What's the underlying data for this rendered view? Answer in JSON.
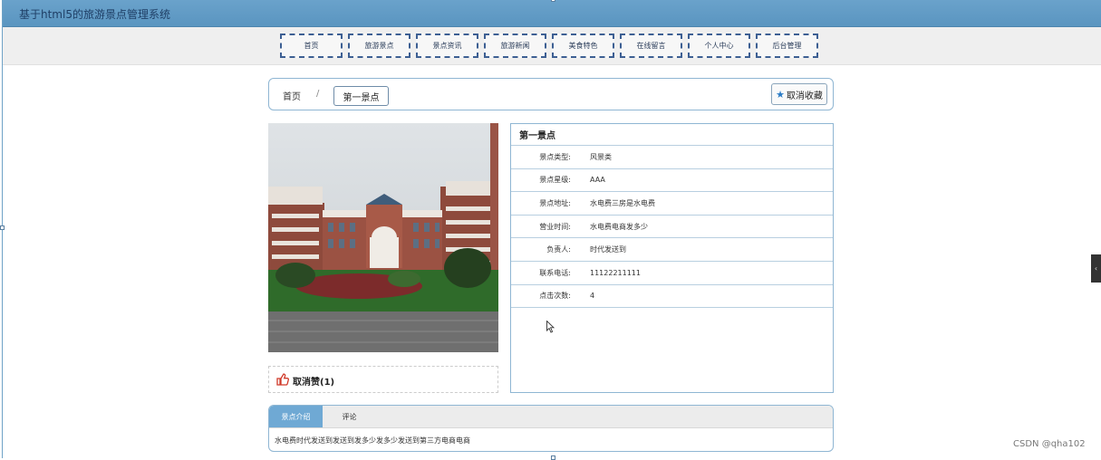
{
  "window": {
    "title": "基于html5的旅游景点管理系统"
  },
  "nav": {
    "items": [
      {
        "label": "首页"
      },
      {
        "label": "旅游景点"
      },
      {
        "label": "景点资讯"
      },
      {
        "label": "旅游新闻"
      },
      {
        "label": "美食特色"
      },
      {
        "label": "在线留言"
      },
      {
        "label": "个人中心"
      },
      {
        "label": "后台管理"
      }
    ]
  },
  "breadcrumb": {
    "home": "首页",
    "separator": "/",
    "current": "第一景点"
  },
  "favorite": {
    "label": "取消收藏",
    "icon": "star-icon"
  },
  "like": {
    "label": "取消赞(1)",
    "icon": "thumbs-up-icon"
  },
  "detail": {
    "name": "第一景点",
    "rows": [
      {
        "key": "景点类型:",
        "value": "风景类"
      },
      {
        "key": "景点星级:",
        "value": "AAA"
      },
      {
        "key": "景点地址:",
        "value": "水电费三房是水电费"
      },
      {
        "key": "营业时间:",
        "value": "水电费电商发多少"
      },
      {
        "key": "负责人:",
        "value": "时代发送到"
      },
      {
        "key": "联系电话:",
        "value": "11122211111"
      },
      {
        "key": "点击次数:",
        "value": "4"
      }
    ]
  },
  "tabs": {
    "items": [
      {
        "label": "景点介绍",
        "active": true
      },
      {
        "label": "评论",
        "active": false
      }
    ],
    "content": "水电费时代发送到发送到发多少发多少发送到第三方电商电商"
  },
  "watermark": "CSDN @qha102",
  "colors": {
    "titlebar": "#5a95c0",
    "nav_border": "#3d5f93",
    "accent": "#6fa9d4"
  }
}
